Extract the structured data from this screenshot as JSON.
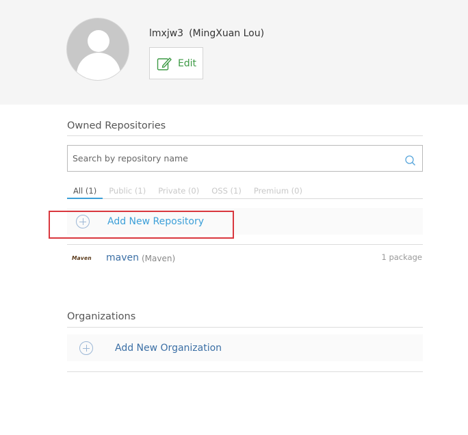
{
  "user": {
    "username": "lmxjw3",
    "fullname": "(MingXuan Lou)",
    "edit_label": "Edit"
  },
  "repositories": {
    "title": "Owned Repositories",
    "search_placeholder": "Search by repository name",
    "tabs": [
      {
        "label": "All (1)",
        "active": true
      },
      {
        "label": "Public (1)",
        "active": false
      },
      {
        "label": "Private (0)",
        "active": false
      },
      {
        "label": "OSS (1)",
        "active": false
      },
      {
        "label": "Premium (0)",
        "active": false
      }
    ],
    "add_label": "Add New Repository",
    "items": [
      {
        "logo_text": "Maven",
        "name": "maven",
        "type": "(Maven)",
        "count": "1 package"
      }
    ]
  },
  "organizations": {
    "title": "Organizations",
    "add_label": "Add New Organization"
  },
  "colors": {
    "accent_blue": "#3b9fd8",
    "link_blue": "#3b6fa5",
    "edit_green": "#3d9a45",
    "highlight_red": "#d9373e"
  },
  "icons": {
    "avatar": "default-user-avatar",
    "edit": "edit-pencil-icon",
    "search": "search-icon",
    "add": "plus-circle-icon"
  }
}
